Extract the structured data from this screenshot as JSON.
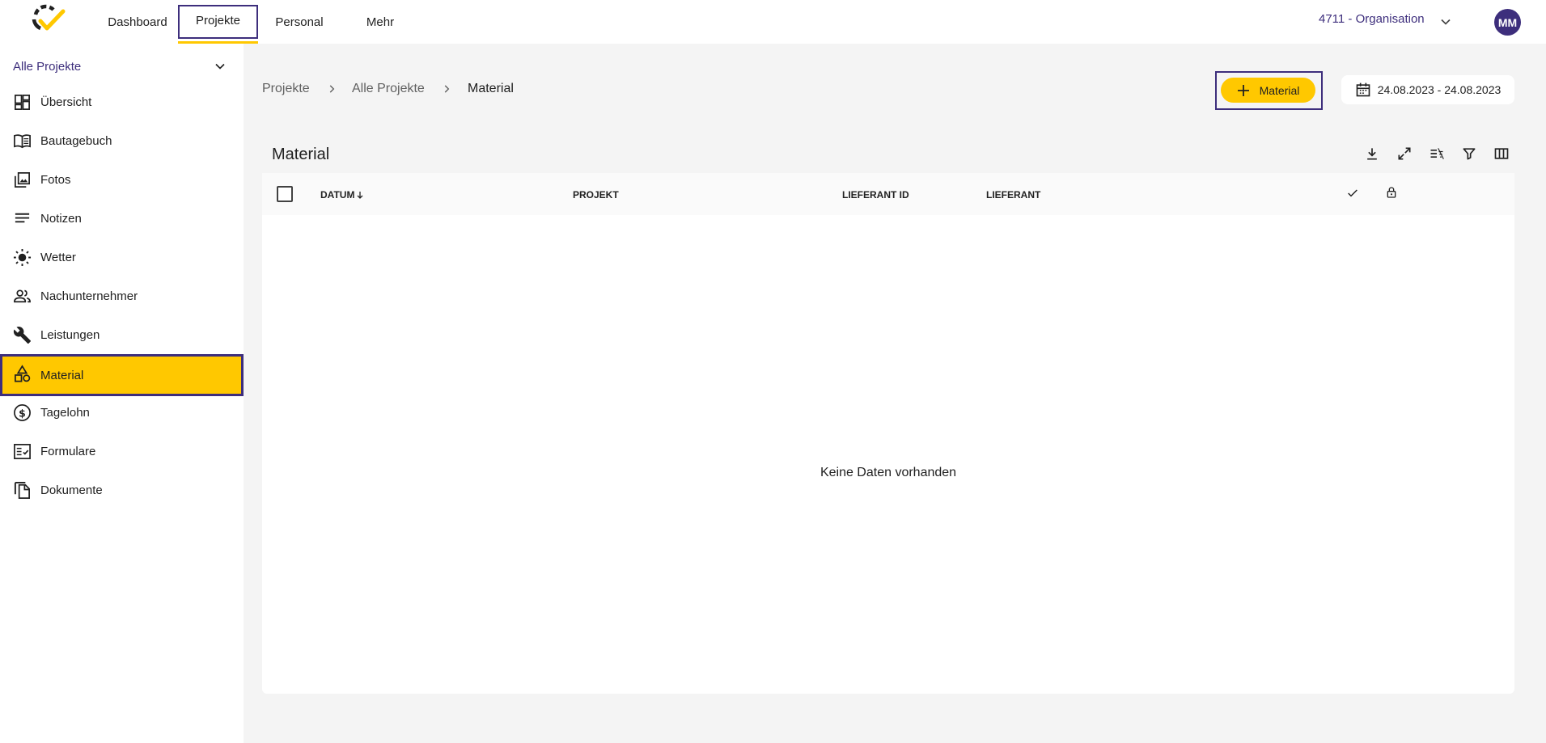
{
  "nav": {
    "items": [
      {
        "label": "Dashboard"
      },
      {
        "label": "Projekte"
      },
      {
        "label": "Personal"
      },
      {
        "label": "Mehr"
      }
    ],
    "organisation": "4711 - Organisation",
    "avatar_initials": "MM"
  },
  "sidebar": {
    "project_select": "Alle Projekte",
    "items": [
      {
        "label": "Übersicht",
        "icon": "dashboard-icon"
      },
      {
        "label": "Bautagebuch",
        "icon": "book-icon"
      },
      {
        "label": "Fotos",
        "icon": "photos-icon"
      },
      {
        "label": "Notizen",
        "icon": "notes-icon"
      },
      {
        "label": "Wetter",
        "icon": "sun-icon"
      },
      {
        "label": "Nachunternehmer",
        "icon": "people-icon"
      },
      {
        "label": "Leistungen",
        "icon": "wrench-icon"
      },
      {
        "label": "Material",
        "icon": "shapes-icon"
      },
      {
        "label": "Tagelohn",
        "icon": "dollar-icon"
      },
      {
        "label": "Formulare",
        "icon": "form-icon"
      },
      {
        "label": "Dokumente",
        "icon": "documents-icon"
      }
    ],
    "active_item": "Material"
  },
  "breadcrumb": [
    "Projekte",
    "Alle Projekte",
    "Material"
  ],
  "header": {
    "add_button_label": "Material",
    "date_range": "24.08.2023 - 24.08.2023"
  },
  "table": {
    "title": "Material",
    "tools": [
      "download-icon",
      "expand-icon",
      "clear-sort-icon",
      "filter-icon",
      "columns-icon"
    ],
    "columns": [
      "DATUM",
      "PROJEKT",
      "LIEFERANT ID",
      "LIEFERANT"
    ],
    "sort_column": "DATUM",
    "sort_direction": "descending",
    "status_column_icons": [
      "check-icon",
      "lock-icon"
    ],
    "empty_message": "Keine Daten vorhanden"
  },
  "colors": {
    "accent_yellow": "#ffc800",
    "brand_purple": "#3d2e7c",
    "background": "#f4f4f4"
  }
}
